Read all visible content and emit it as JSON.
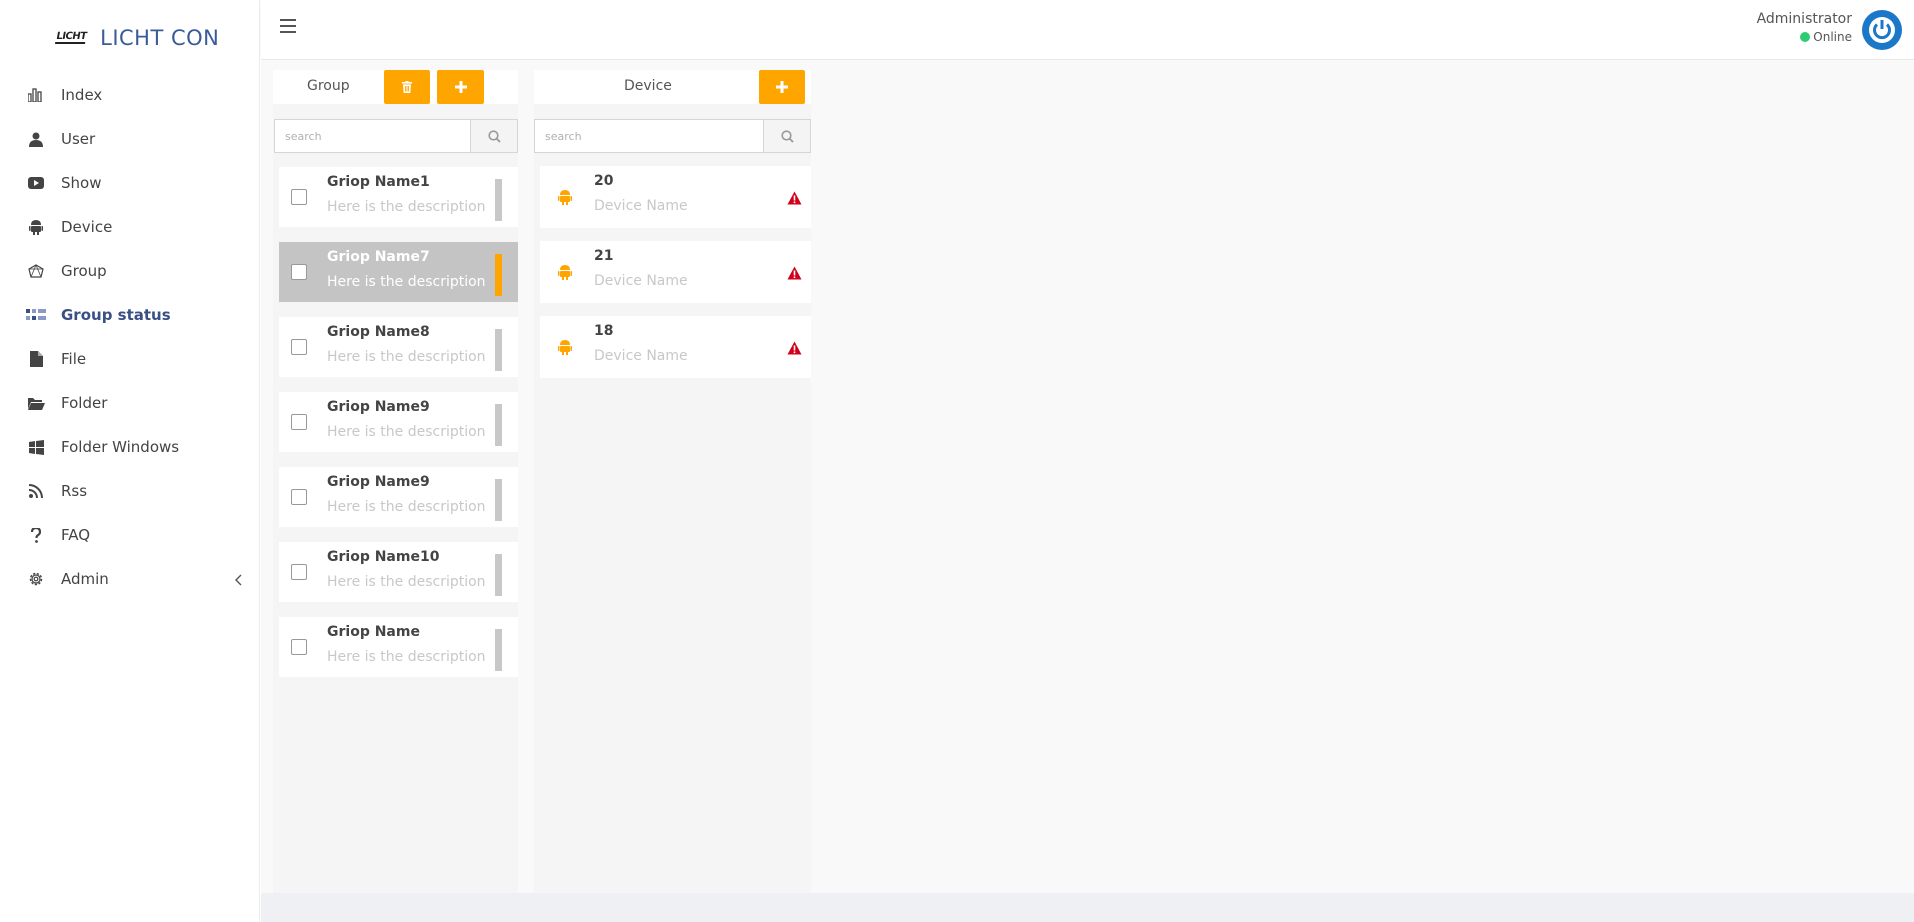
{
  "brand": {
    "logo_text": "LICHT",
    "name": "LICHT CON"
  },
  "sidebar": {
    "items": [
      {
        "label": "Index",
        "icon": "bar-chart-icon"
      },
      {
        "label": "User",
        "icon": "user-icon"
      },
      {
        "label": "Show",
        "icon": "youtube-icon"
      },
      {
        "label": "Device",
        "icon": "android-icon"
      },
      {
        "label": "Group",
        "icon": "network-icon"
      },
      {
        "label": "Group status",
        "icon": "group-status-icon",
        "active": true
      },
      {
        "label": "File",
        "icon": "file-icon"
      },
      {
        "label": "Folder",
        "icon": "folder-open-icon"
      },
      {
        "label": "Folder Windows",
        "icon": "windows-icon"
      },
      {
        "label": "Rss",
        "icon": "rss-icon"
      },
      {
        "label": "FAQ",
        "icon": "question-icon"
      },
      {
        "label": "Admin",
        "icon": "gear-icon",
        "has_submenu": true
      }
    ]
  },
  "header": {
    "user_name": "Administrator",
    "user_status": "Online"
  },
  "group_panel": {
    "title": "Group",
    "search_placeholder": "search",
    "groups": [
      {
        "name": "Griop Name1",
        "description": "Here is the description",
        "selected": false
      },
      {
        "name": "Griop Name7",
        "description": "Here is the description",
        "selected": true
      },
      {
        "name": "Griop Name8",
        "description": "Here is the description",
        "selected": false
      },
      {
        "name": "Griop Name9",
        "description": "Here is the description",
        "selected": false
      },
      {
        "name": "Griop Name9",
        "description": "Here is the description",
        "selected": false
      },
      {
        "name": "Griop Name10",
        "description": "Here is the description",
        "selected": false
      },
      {
        "name": "Griop Name",
        "description": "Here is the description",
        "selected": false
      }
    ]
  },
  "device_panel": {
    "title": "Device",
    "search_placeholder": "search",
    "devices": [
      {
        "id": "20",
        "name": "Device Name",
        "status": "warning"
      },
      {
        "id": "21",
        "name": "Device Name",
        "status": "warning"
      },
      {
        "id": "18",
        "name": "Device Name",
        "status": "warning"
      }
    ]
  },
  "colors": {
    "accent": "#ffa500",
    "brand": "#3a5a9a",
    "online": "#2ecc71",
    "warning": "#d0021b",
    "avatar": "#1b78c9"
  }
}
